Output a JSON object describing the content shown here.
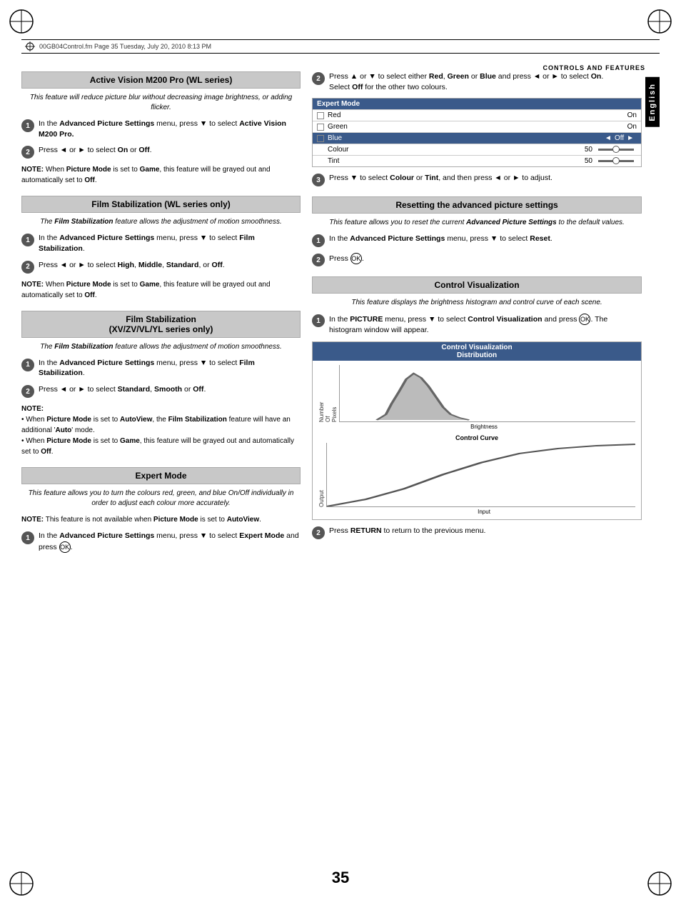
{
  "page": {
    "number": "35",
    "header_text": "00GB04Control.fm  Page 35  Tuesday, July 20, 2010  8:13 PM",
    "top_right_label": "CONTROLS AND FEATURES",
    "sidebar_label": "English"
  },
  "left_col": {
    "section1": {
      "title": "Active Vision M200 Pro (WL series)",
      "subtitle": "This feature will reduce picture blur without decreasing image brightness, or adding flicker.",
      "step1": "In the Advanced Picture Settings menu, press ▼ to select Active Vision M200 Pro.",
      "step2": "Press ◄ or ► to select On or Off.",
      "note": "NOTE: When Picture Mode is set to Game, this feature will be grayed out and automatically set to Off."
    },
    "section2": {
      "title": "Film Stabilization (WL series only)",
      "subtitle": "The Film Stabilization feature allows the adjustment of motion smoothness.",
      "step1": "In the Advanced Picture Settings menu, press ▼ to select Film Stabilization.",
      "step2": "Press ◄ or ► to select High, Middle, Standard, or Off.",
      "note": "NOTE: When Picture Mode is set to Game, this feature will be grayed out and automatically set to Off."
    },
    "section3": {
      "title_line1": "Film Stabilization",
      "title_line2": "(XV/ZV/VL/YL series only)",
      "subtitle": "The Film Stabilization feature allows the adjustment of motion smoothness.",
      "step1": "In the Advanced Picture Settings menu, press ▼ to select Film Stabilization.",
      "step2": "Press ◄ or ► to select Standard, Smooth or Off.",
      "note_title": "NOTE:",
      "note_bullet1": "• When Picture Mode is set to AutoView, the Film Stabilization feature will have an additional 'Auto' mode.",
      "note_bullet2": "• When Picture Mode is set to Game, this feature will be grayed out and automatically set to Off."
    },
    "section4": {
      "title": "Expert Mode",
      "subtitle": "This feature allows you to turn the colours red, green, and blue On/Off individually in order to adjust each colour more accurately.",
      "note": "NOTE: This feature is not available when Picture Mode is set to AutoView.",
      "step1": "In the Advanced Picture Settings menu, press ▼ to select Expert Mode and press OK."
    }
  },
  "right_col": {
    "section1_step2": "Press ▲ or ▼ to select either Red, Green or Blue and press ◄ or ► to select On. Select Off for the other two colours.",
    "expert_table": {
      "header": "Expert Mode",
      "rows": [
        {
          "label": "Red",
          "value": "On",
          "selected": false,
          "color": "empty"
        },
        {
          "label": "Green",
          "value": "On",
          "selected": false,
          "color": "empty"
        },
        {
          "label": "Blue",
          "value": "Off",
          "selected": true,
          "color": "blue",
          "has_arrows": true
        },
        {
          "label": "Colour",
          "value": "50",
          "selected": false,
          "has_slider": true
        },
        {
          "label": "Tint",
          "value": "50",
          "selected": false,
          "has_slider": true
        }
      ]
    },
    "section1_step3": "Press ▼ to select Colour or Tint, and then press ◄ or ► to adjust.",
    "section2": {
      "title": "Resetting the advanced picture settings",
      "subtitle": "This feature allows you to reset the current Advanced Picture Settings to the default values.",
      "step1": "In the Advanced Picture Settings menu, press ▼ to select Reset.",
      "step2": "Press OK."
    },
    "section3": {
      "title": "Control Visualization",
      "subtitle": "This feature displays the brightness histogram and control curve of each scene.",
      "step1": "In the PICTURE menu, press ▼ to select Control Visualization and press OK. The histogram window will appear.",
      "chart": {
        "title": "Control Visualization Distribution",
        "dist_label_y": "Number Of Pixels",
        "dist_label_x": "Brightness",
        "curve_title": "Control Curve",
        "curve_label_y": "Output",
        "curve_label_x": "Input"
      },
      "step2": "Press RETURN to return to the previous menu."
    }
  }
}
